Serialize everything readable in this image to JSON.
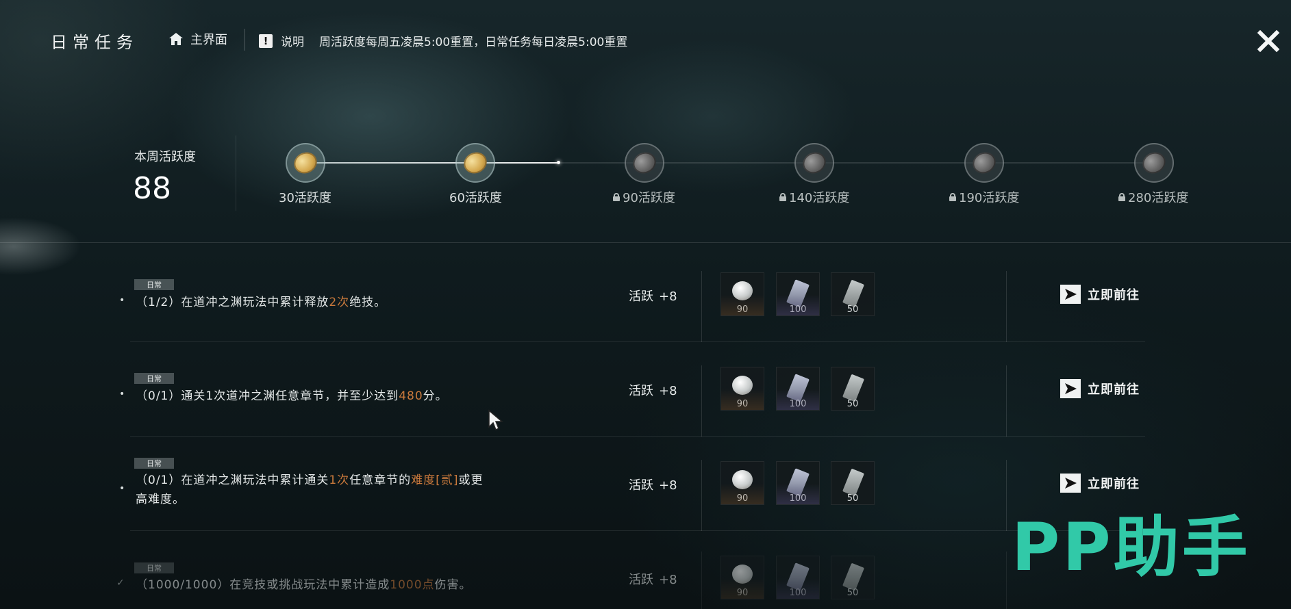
{
  "header": {
    "title": "日常任务",
    "home_label": "主界面",
    "info_label": "说明",
    "info_text": "周活跃度每周五凌晨5:00重置，日常任务每日凌晨5:00重置"
  },
  "weekly": {
    "label": "本周活跃度",
    "value": "88",
    "progress_points": 88,
    "milestones": [
      {
        "label": "30活跃度",
        "unlocked": true
      },
      {
        "label": "60活跃度",
        "unlocked": true
      },
      {
        "label": "90活跃度",
        "unlocked": false
      },
      {
        "label": "140活跃度",
        "unlocked": false
      },
      {
        "label": "190活跃度",
        "unlocked": false
      },
      {
        "label": "280活跃度",
        "unlocked": false
      }
    ]
  },
  "tasks": [
    {
      "tag": "日常",
      "progress": "（1/2）",
      "desc_a": "在道冲之渊玩法中累计释放",
      "hl_1": "2次",
      "desc_b": "绝技。",
      "points_label": "活跃",
      "points_value": "+8",
      "rewards": [
        "90",
        "100",
        "50"
      ],
      "go_label": "立即前往"
    },
    {
      "tag": "日常",
      "progress": "（0/1）",
      "desc_a": "通关1次道冲之渊任意章节，并至少达到",
      "hl_1": "480",
      "desc_b": "分。",
      "points_label": "活跃",
      "points_value": "+8",
      "rewards": [
        "90",
        "100",
        "50"
      ],
      "go_label": "立即前往"
    },
    {
      "tag": "日常",
      "progress": "（0/1）",
      "desc_a": "在道冲之渊玩法中累计通关",
      "hl_1": "1次",
      "desc_b": "任意章节的",
      "hl_2": "难度[贰]",
      "desc_c": "或更",
      "desc_d": "高难度。",
      "points_label": "活跃",
      "points_value": "+8",
      "rewards": [
        "90",
        "100",
        "50"
      ],
      "go_label": "立即前往"
    },
    {
      "tag": "日常",
      "progress": "（1000/1000）",
      "desc_a": "在竞技或挑战玩法中累计造成",
      "hl_1": "1000点",
      "desc_b": "伤害。",
      "points_label": "活跃",
      "points_value": "+8",
      "rewards": [
        "90",
        "100",
        "50"
      ],
      "done": true
    }
  ],
  "watermark": "PP助手",
  "colors": {
    "highlight": "#c9793c",
    "watermark": "#31c9a8",
    "background": "#0c1416"
  },
  "icons": {
    "home": "home-icon",
    "info": "exclamation-icon",
    "close": "close-icon",
    "go": "arrow-right-icon",
    "lock": "lock-icon",
    "check": "checkmark-icon"
  }
}
